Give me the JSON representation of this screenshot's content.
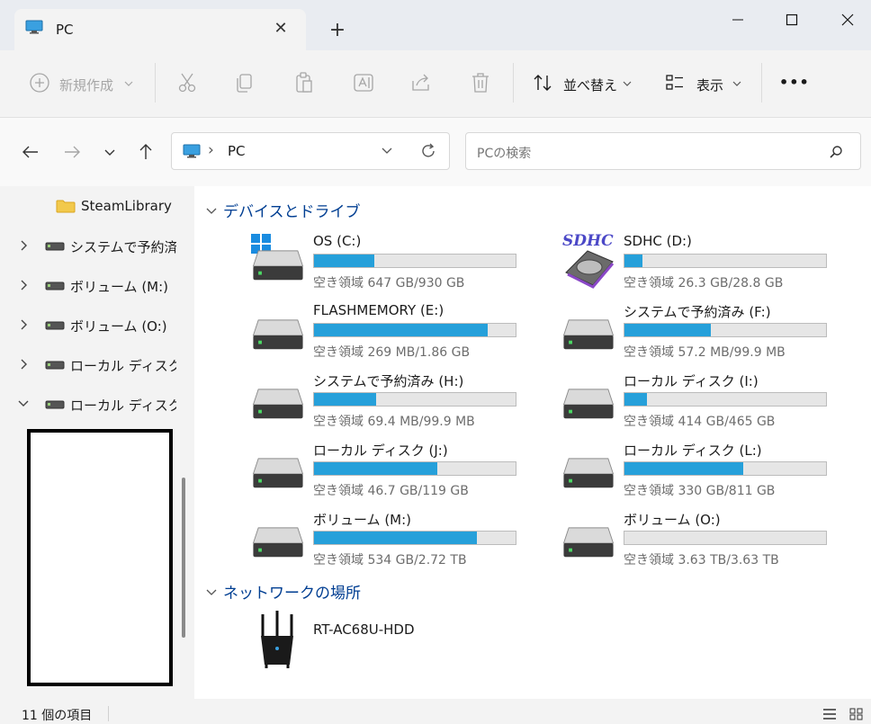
{
  "window": {
    "tab_title": "PC",
    "new_tab_symbol": "+",
    "close_tab_symbol": "✕"
  },
  "toolbar": {
    "new_label": "新規作成",
    "sort_label": "並べ替え",
    "view_label": "表示",
    "more_label": "•••"
  },
  "address": {
    "path_separator": "›",
    "path": "PC",
    "search_placeholder": "PCの検索"
  },
  "sidebar": {
    "items": [
      {
        "label": "SteamLibrary",
        "type": "folder",
        "chevron": ""
      },
      {
        "label": "システムで予約済み",
        "type": "drive",
        "chevron": "right"
      },
      {
        "label": "ボリューム (M:)",
        "type": "drive",
        "chevron": "right"
      },
      {
        "label": "ボリューム (O:)",
        "type": "drive",
        "chevron": "right"
      },
      {
        "label": "ローカル ディスク (I:)",
        "type": "drive",
        "chevron": "right"
      },
      {
        "label": "ローカル ディスク (J:)",
        "type": "drive",
        "chevron": "down"
      }
    ]
  },
  "content": {
    "devices_header": "デバイスとドライブ",
    "network_header": "ネットワークの場所",
    "drives": [
      {
        "name": "OS (C:)",
        "free": "空き領域 647 GB/930 GB",
        "used_fraction": 0.3,
        "icon": "windows-drive"
      },
      {
        "name": "SDHC (D:)",
        "free": "空き領域 26.3 GB/28.8 GB",
        "used_fraction": 0.09,
        "icon": "sdhc-drive",
        "icon_text": "SDHC"
      },
      {
        "name": "FLASHMEMORY (E:)",
        "free": "空き領域 269 MB/1.86 GB",
        "used_fraction": 0.86,
        "icon": "drive"
      },
      {
        "name": "システムで予約済み (F:)",
        "free": "空き領域 57.2 MB/99.9 MB",
        "used_fraction": 0.43,
        "icon": "drive"
      },
      {
        "name": "システムで予約済み (H:)",
        "free": "空き領域 69.4 MB/99.9 MB",
        "used_fraction": 0.31,
        "icon": "drive"
      },
      {
        "name": "ローカル ディスク (I:)",
        "free": "空き領域 414 GB/465 GB",
        "used_fraction": 0.11,
        "icon": "drive"
      },
      {
        "name": "ローカル ディスク (J:)",
        "free": "空き領域 46.7 GB/119 GB",
        "used_fraction": 0.61,
        "icon": "drive"
      },
      {
        "name": "ローカル ディスク (L:)",
        "free": "空き領域 330 GB/811 GB",
        "used_fraction": 0.59,
        "icon": "drive"
      },
      {
        "name": "ボリューム (M:)",
        "free": "空き領域 534 GB/2.72 TB",
        "used_fraction": 0.81,
        "icon": "drive"
      },
      {
        "name": "ボリューム (O:)",
        "free": "空き領域 3.63 TB/3.63 TB",
        "used_fraction": 0.0,
        "icon": "drive"
      }
    ],
    "network_item": "RT-AC68U-HDD"
  },
  "status": {
    "item_count": "11 個の項目"
  },
  "colors": {
    "bar_fill": "#26a0da",
    "section_header": "#003e92"
  }
}
